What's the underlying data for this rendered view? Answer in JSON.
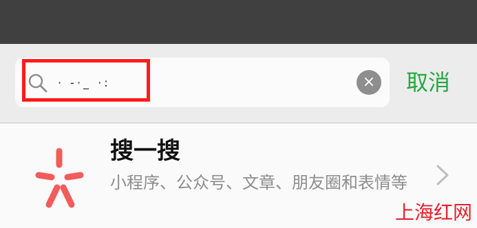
{
  "search": {
    "input_value": "· -·_ ·:",
    "clear_label": "×",
    "cancel_label": "取消"
  },
  "result": {
    "title": "搜一搜",
    "subtitle": "小程序、公众号、文章、朋友圈和表情等"
  },
  "watermark": {
    "text": "上海红网"
  },
  "colors": {
    "accent_green": "#24a843",
    "highlight_red": "#ff1a1a",
    "icon_red": "#f45b5b"
  },
  "icons": {
    "search": "search-icon",
    "clear": "clear-icon",
    "result": "sparkle-icon",
    "chevron": "chevron-right-icon"
  }
}
